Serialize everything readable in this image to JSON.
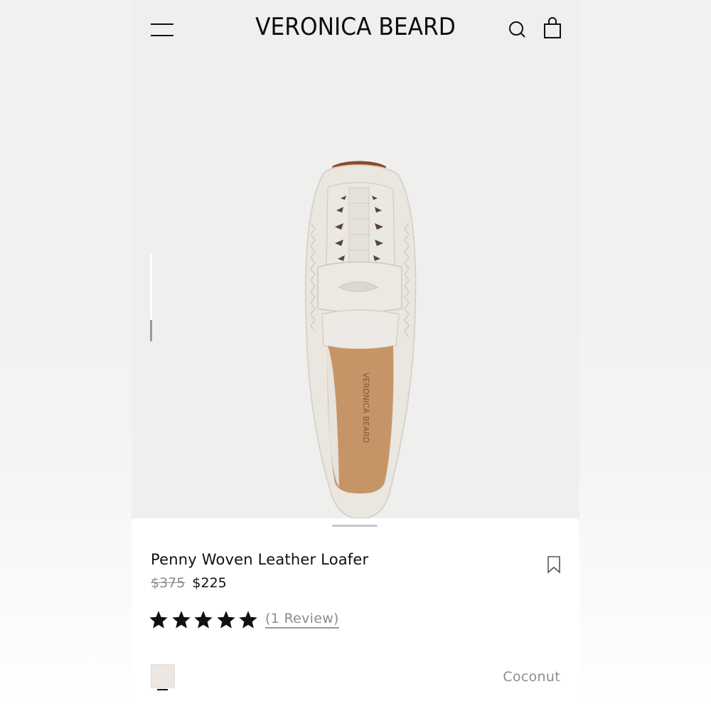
{
  "header": {
    "brand": "VERONICA BEARD",
    "icons": {
      "menu": "menu-icon",
      "search": "search-icon",
      "cart": "shopping-bag-icon"
    }
  },
  "gallery": {
    "image": "white-woven-leather-loafer",
    "insole_text": "VERONICA BEARD"
  },
  "product": {
    "title": "Penny Woven Leather Loafer",
    "original_price": "$375",
    "sale_price": "$225",
    "rating": 5,
    "rating_max": 5,
    "reviews_label": "(1 Review)",
    "color_name": "Coconut",
    "swatch_color": "#ece7e2",
    "bookmark_icon": "bookmark-icon",
    "star_icon": "star-icon"
  },
  "colors": {
    "text": "#111111",
    "muted": "#8d8d8d",
    "background": "#efefee"
  }
}
